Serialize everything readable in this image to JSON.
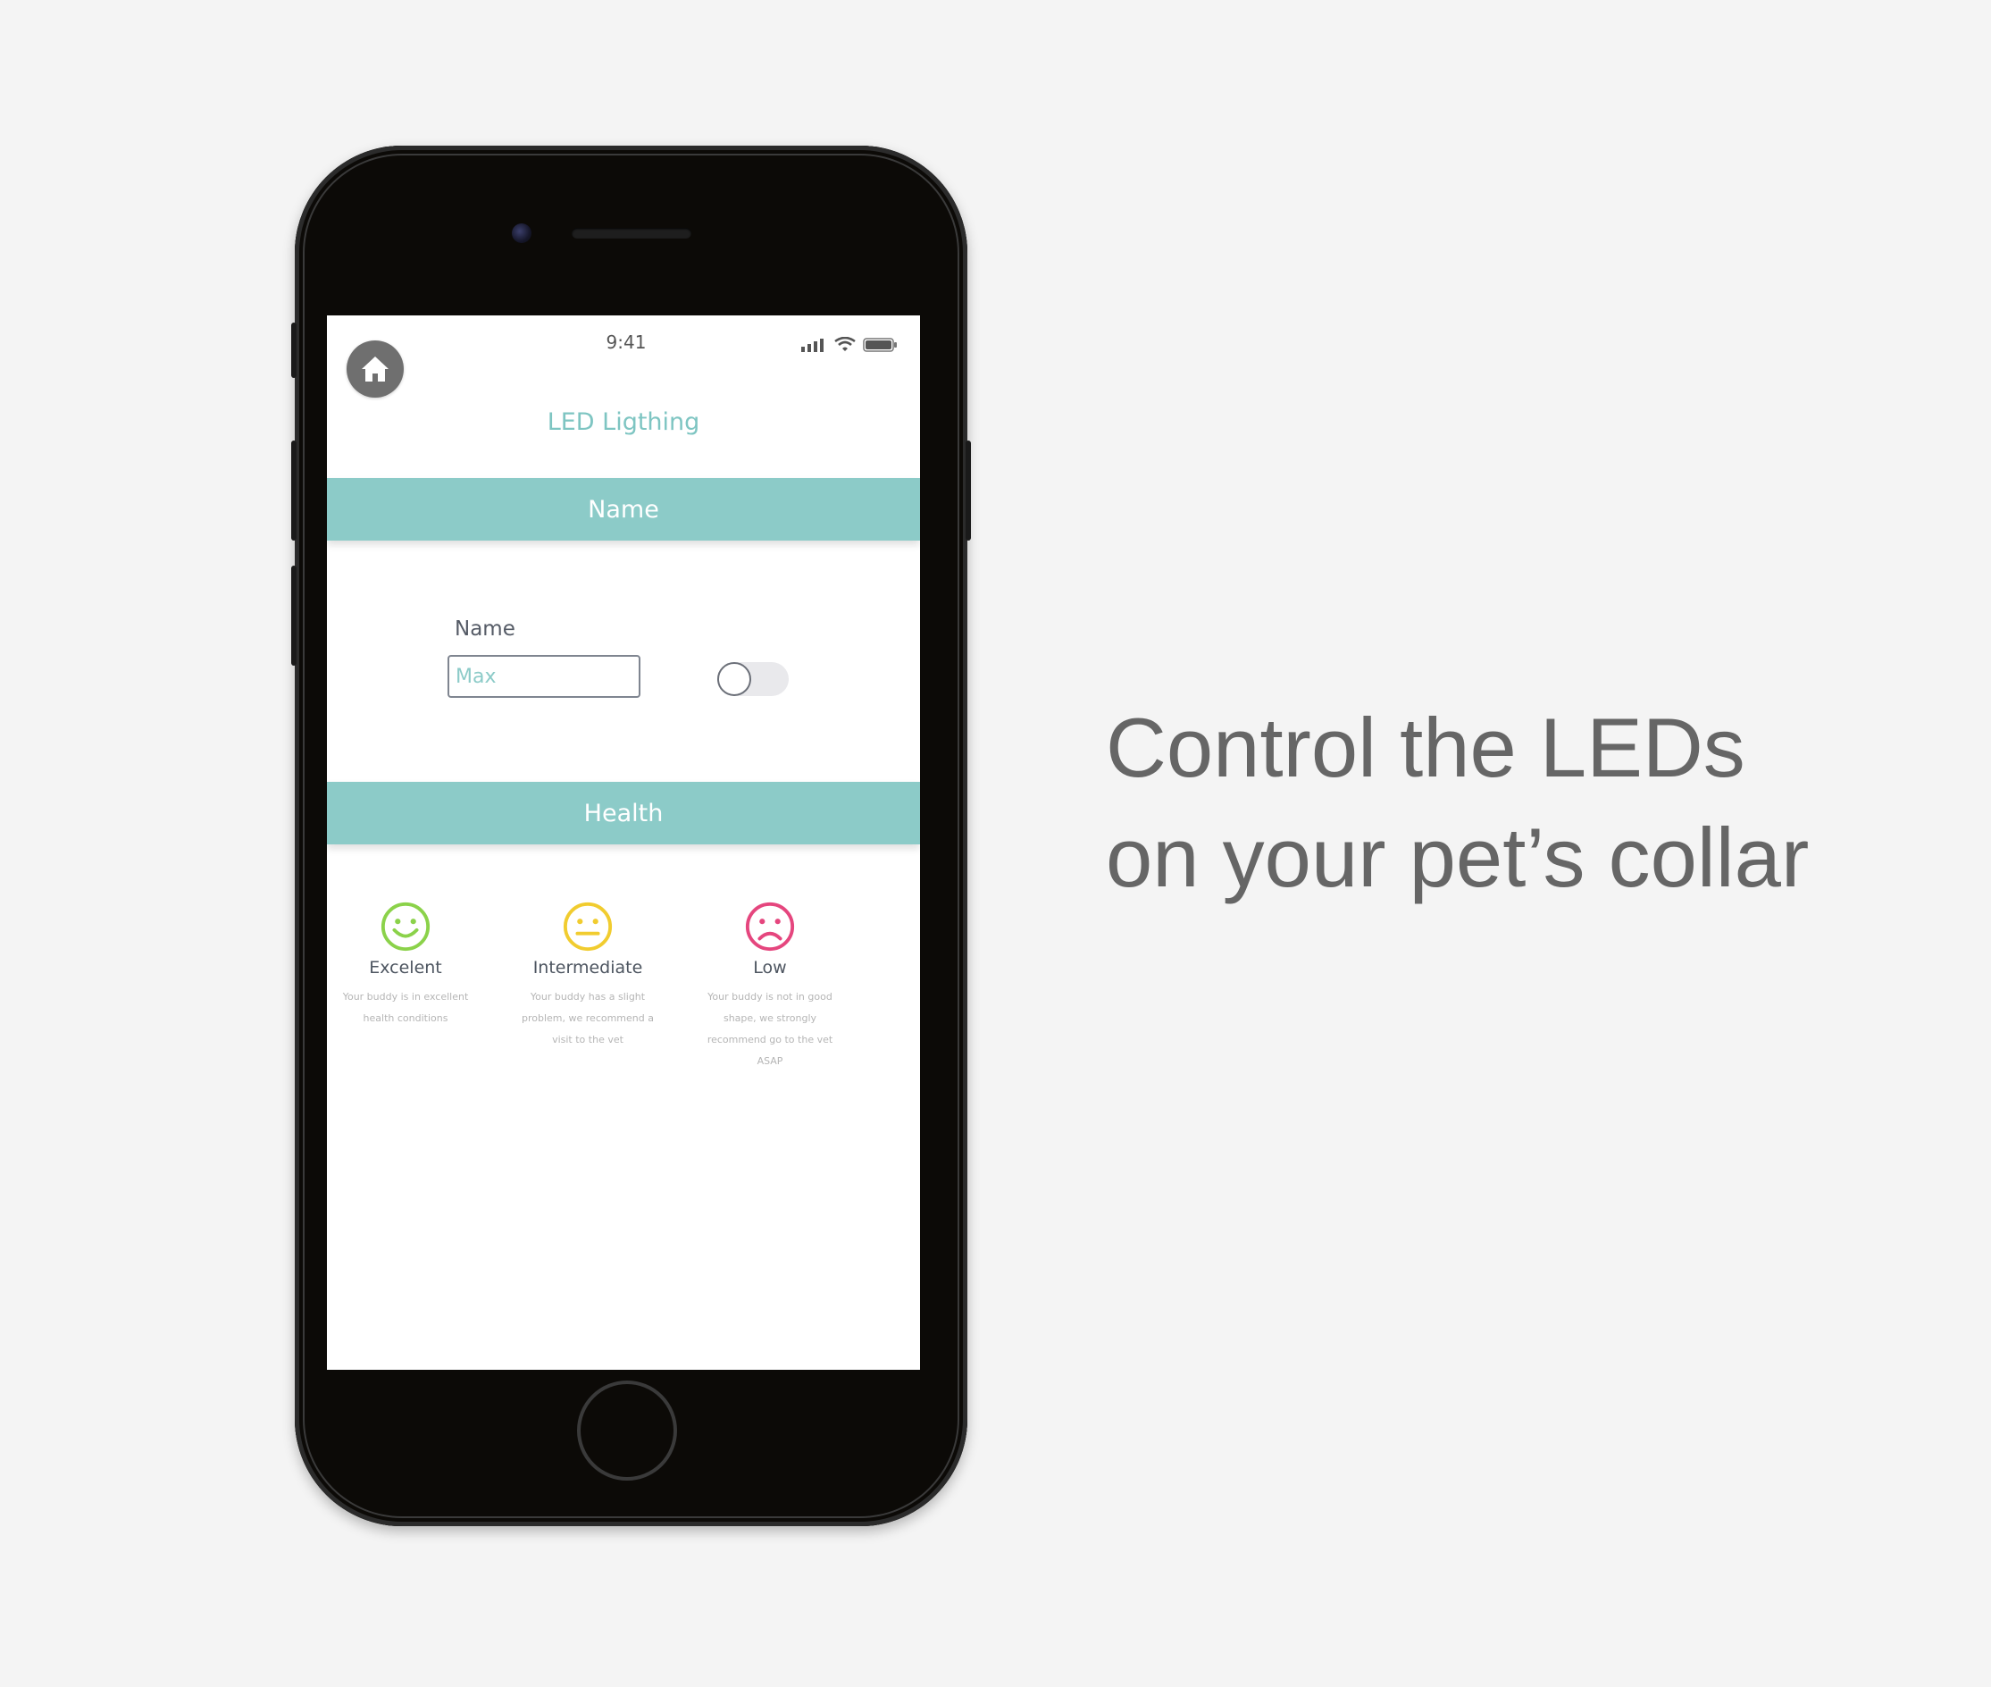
{
  "status_bar": {
    "time": "9:41"
  },
  "screen": {
    "title": "LED Ligthing",
    "name_section": {
      "header": "Name",
      "field_label": "Name",
      "field_value": "Max",
      "toggle_on": false
    },
    "health_section": {
      "header": "Health",
      "levels": [
        {
          "label": "Excelent",
          "description": "Your buddy is in excellent health conditions",
          "color": "#8bd24a",
          "icon": "smiley-happy-icon"
        },
        {
          "label": "Intermediate",
          "description": "Your buddy has a slight problem, we recommend a visit to the vet",
          "color": "#f1cc2f",
          "icon": "smiley-neutral-icon"
        },
        {
          "label": "Low",
          "description": "Your buddy is not in good shape, we strongly recommend go to the vet ASAP",
          "color": "#e5467e",
          "icon": "smiley-sad-icon"
        }
      ]
    }
  },
  "tagline": {
    "line1": "Control the LEDs",
    "line2": "on your pet’s collar"
  },
  "colors": {
    "accent": "#8ccbc8",
    "background": "#f4f4f4",
    "tagline": "#666666"
  }
}
